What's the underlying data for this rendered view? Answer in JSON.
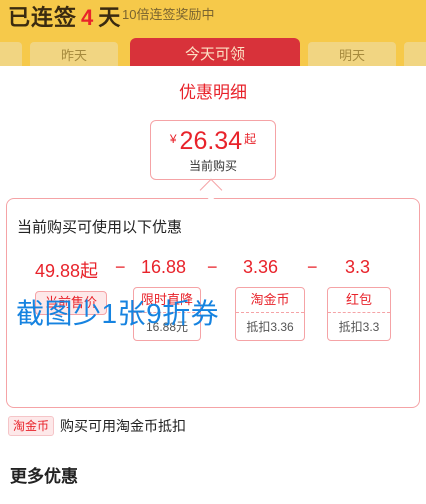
{
  "banner": {
    "streak_prefix": "已连签",
    "streak_days": "4",
    "streak_suffix": "天",
    "subtitle": "10倍连签奖励中",
    "day_yesterday": "昨天",
    "day_today": "今天可领",
    "day_tomorrow": "明天"
  },
  "sheet": {
    "title": "优惠明细",
    "price": {
      "currency": "¥",
      "amount": "26.34",
      "suffix": "起",
      "label": "当前购买"
    },
    "detail": {
      "heading": "当前购买可使用以下优惠",
      "values": [
        "49.88起",
        "16.88",
        "3.36",
        "3.3"
      ],
      "operators": [
        "−",
        "−",
        "−"
      ],
      "tags": [
        {
          "head": "当前售价",
          "sub": ""
        },
        {
          "head": "限时直降",
          "sub": "16.88元"
        },
        {
          "head": "淘金币",
          "sub": "抵扣3.36"
        },
        {
          "head": "红包",
          "sub": "抵扣3.3"
        }
      ]
    },
    "overlay_text": "截图少1张9折券",
    "coin_note": {
      "badge": "淘金币",
      "text": "购买可用淘金币抵扣"
    },
    "more_title": "更多优惠"
  },
  "colors": {
    "accent": "#e8232b",
    "banner": "#f6c94a",
    "overlay": "#1683e0"
  }
}
